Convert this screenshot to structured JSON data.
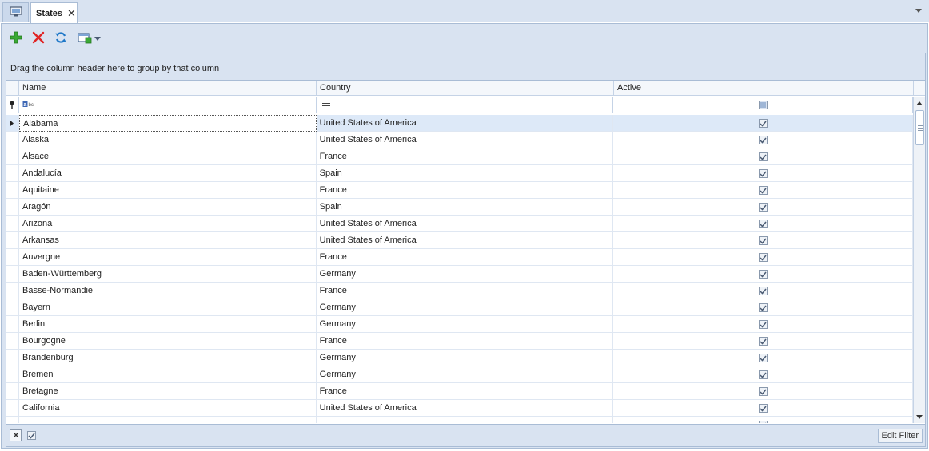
{
  "tabs": {
    "home_icon": "monitor-icon",
    "active_label": "States",
    "close_symbol": "✕",
    "overflow_icon": "chevron-down-icon"
  },
  "toolbar": {
    "add_icon": "add-icon",
    "delete_icon": "delete-icon",
    "refresh_icon": "refresh-icon",
    "view_icon": "view-settings-icon"
  },
  "grid": {
    "group_hint": "Drag the column header here to group by that column",
    "columns": [
      "Name",
      "Country",
      "Active"
    ],
    "filter": {
      "name_icon": "text-filter-icon",
      "country_icon": "equals-icon"
    },
    "selected_row": 0,
    "rows": [
      {
        "name": "Alabama",
        "country": "United States of America",
        "active": true
      },
      {
        "name": "Alaska",
        "country": "United States of America",
        "active": true
      },
      {
        "name": "Alsace",
        "country": "France",
        "active": true
      },
      {
        "name": "Andalucía",
        "country": "Spain",
        "active": true
      },
      {
        "name": "Aquitaine",
        "country": "France",
        "active": true
      },
      {
        "name": "Aragón",
        "country": "Spain",
        "active": true
      },
      {
        "name": "Arizona",
        "country": "United States of America",
        "active": true
      },
      {
        "name": "Arkansas",
        "country": "United States of America",
        "active": true
      },
      {
        "name": "Auvergne",
        "country": "France",
        "active": true
      },
      {
        "name": "Baden-Württemberg",
        "country": "Germany",
        "active": true
      },
      {
        "name": "Basse-Normandie",
        "country": "France",
        "active": true
      },
      {
        "name": "Bayern",
        "country": "Germany",
        "active": true
      },
      {
        "name": "Berlin",
        "country": "Germany",
        "active": true
      },
      {
        "name": "Bourgogne",
        "country": "France",
        "active": true
      },
      {
        "name": "Brandenburg",
        "country": "Germany",
        "active": true
      },
      {
        "name": "Bremen",
        "country": "Germany",
        "active": true
      },
      {
        "name": "Bretagne",
        "country": "France",
        "active": true
      },
      {
        "name": "California",
        "country": "United States of America",
        "active": true
      },
      {
        "name": "",
        "country": "",
        "active": true
      }
    ]
  },
  "footer": {
    "close_symbol": "✕",
    "edit_filter_label": "Edit Filter"
  },
  "colors": {
    "frame": "#d9e3f1",
    "border": "#a9bcd5",
    "selected_row": "#dde9f8",
    "add_green": "#3aa935",
    "delete_red": "#e02424",
    "refresh_blue": "#1f78c8"
  }
}
